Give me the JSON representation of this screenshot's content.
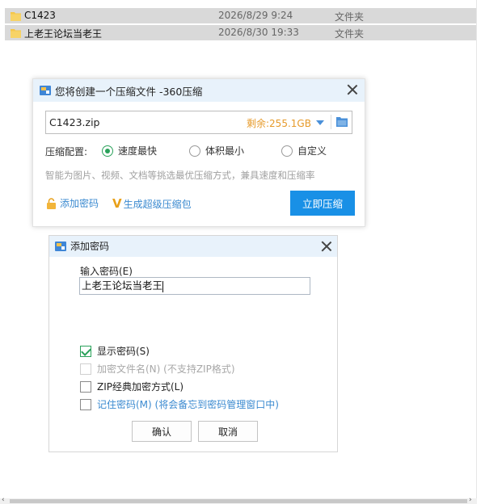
{
  "files": [
    {
      "name": "C1423",
      "date": "2026/8/29 9:24",
      "type": "文件夹"
    },
    {
      "name": "上老王论坛当老王",
      "date": "2026/8/30 19:33",
      "type": "文件夹"
    }
  ],
  "compress_dialog": {
    "title": "您将创建一个压缩文件 -360压缩",
    "filename": "C1423.zip",
    "free_space": "剩余:255.1GB",
    "config_label": "压缩配置:",
    "options": [
      {
        "label": "速度最快",
        "selected": true
      },
      {
        "label": "体积最小",
        "selected": false
      },
      {
        "label": "自定义",
        "selected": false
      }
    ],
    "hint": "智能为图片、视频、文档等挑选最优压缩方式，兼具速度和压缩率",
    "add_password": "添加密码",
    "super_compress_badge": "V",
    "super_compress": "生成超级压缩包",
    "compress_button": "立即压缩"
  },
  "password_dialog": {
    "title": "添加密码",
    "input_label": "输入密码(E)",
    "password_value": "上老王论坛当老王",
    "checkboxes": [
      {
        "label": "显示密码(S)",
        "checked": true,
        "enabled": true
      },
      {
        "label": "加密文件名(N) (不支持ZIP格式)",
        "checked": false,
        "enabled": false
      },
      {
        "label": "ZIP经典加密方式(L)",
        "checked": false,
        "enabled": true
      },
      {
        "label": "记住密码(M) (将会备忘到密码管理窗口中)",
        "checked": false,
        "enabled": true
      }
    ],
    "ok_button": "确认",
    "cancel_button": "取消"
  },
  "colors": {
    "accent": "#1990e6",
    "link": "#3b8ad0",
    "check_green": "#2aa15a",
    "space_orange": "#e69a2a",
    "title_bar": "#e8f2fb",
    "selection": "#d9d9d9"
  }
}
